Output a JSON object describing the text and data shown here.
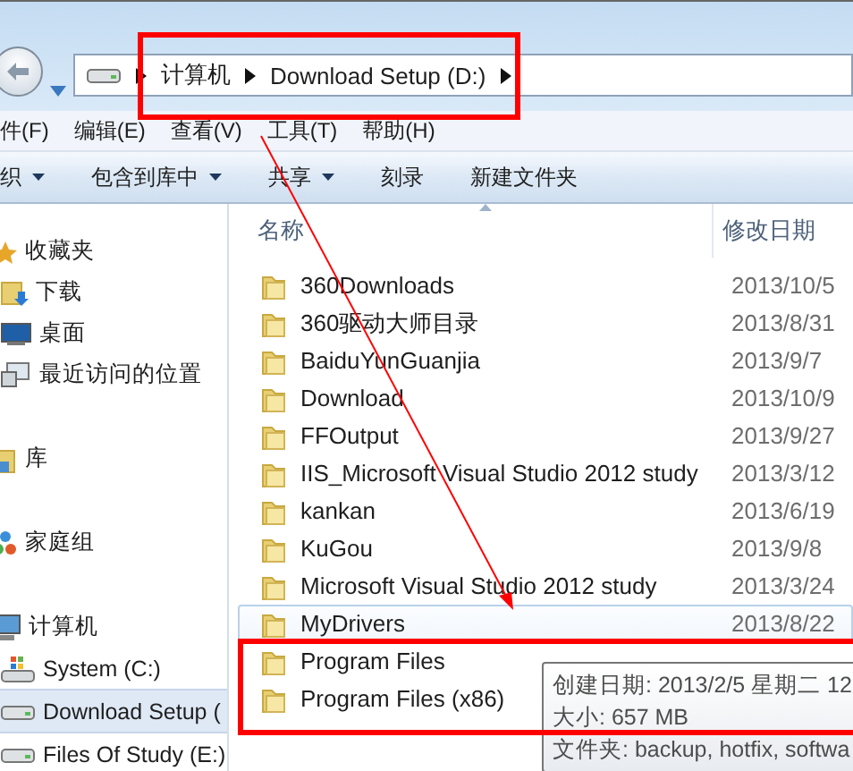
{
  "address_bar": {
    "crumbs": [
      "计算机",
      "Download Setup (D:)"
    ]
  },
  "menu": [
    "件(F)",
    "编辑(E)",
    "查看(V)",
    "工具(T)",
    "帮助(H)"
  ],
  "toolbar": [
    {
      "label": "织",
      "dropdown": true
    },
    {
      "label": "包含到库中",
      "dropdown": true
    },
    {
      "label": "共享",
      "dropdown": true
    },
    {
      "label": "刻录",
      "dropdown": false
    },
    {
      "label": "新建文件夹",
      "dropdown": false
    }
  ],
  "nav": [
    {
      "label": "收藏夹",
      "kind": "star",
      "selected": false,
      "children": [
        {
          "label": "下载",
          "kind": "download",
          "selected": false
        },
        {
          "label": "桌面",
          "kind": "desktop",
          "selected": false
        },
        {
          "label": "最近访问的位置",
          "kind": "recent",
          "selected": false
        }
      ]
    },
    {
      "label": "库",
      "kind": "library",
      "selected": false
    },
    {
      "label": "家庭组",
      "kind": "homegroup",
      "selected": false
    },
    {
      "label": "计算机",
      "kind": "computer",
      "selected": false,
      "children": [
        {
          "label": "System (C:)",
          "kind": "system",
          "selected": false
        },
        {
          "label": "Download Setup (",
          "kind": "drive",
          "selected": true
        },
        {
          "label": "Files Of Study (E:)",
          "kind": "drive",
          "selected": false
        }
      ]
    }
  ],
  "columns": [
    "名称",
    "修改日期"
  ],
  "rows": [
    {
      "name": "360Downloads",
      "date": "2013/10/5",
      "hovered": false
    },
    {
      "name": "360驱动大师目录",
      "date": "2013/8/31",
      "hovered": false
    },
    {
      "name": "BaiduYunGuanjia",
      "date": "2013/9/7",
      "hovered": false
    },
    {
      "name": "Download",
      "date": "2013/10/9",
      "hovered": false
    },
    {
      "name": "FFOutput",
      "date": "2013/9/27",
      "hovered": false
    },
    {
      "name": "IIS_Microsoft Visual Studio 2012 study",
      "date": "2013/3/12",
      "hovered": false
    },
    {
      "name": "kankan",
      "date": "2013/6/19",
      "hovered": false
    },
    {
      "name": "KuGou",
      "date": "2013/9/8",
      "hovered": false
    },
    {
      "name": "Microsoft Visual Studio 2012 study",
      "date": "2013/3/24",
      "hovered": false
    },
    {
      "name": "MyDrivers",
      "date": "2013/8/22",
      "hovered": true
    },
    {
      "name": "Program Files",
      "date": "",
      "hovered": false
    },
    {
      "name": "Program Files (x86)",
      "date": "",
      "hovered": false
    }
  ],
  "tooltip": [
    "创建日期: 2013/2/5 星期二 12",
    "大小: 657 MB",
    "文件夹: backup, hotfix, softwa"
  ]
}
